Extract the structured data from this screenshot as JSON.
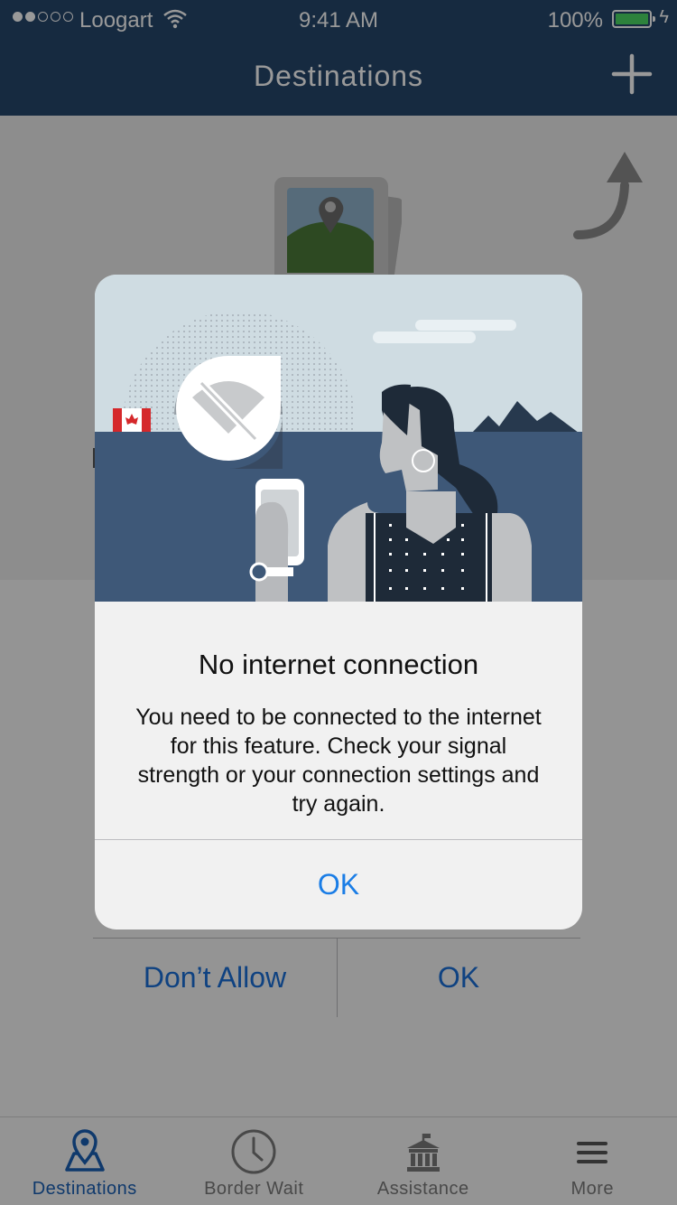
{
  "status_bar": {
    "carrier": "Loogart",
    "time": "9:41 AM",
    "battery": "100%"
  },
  "nav": {
    "title": "Destinations"
  },
  "permission": {
    "deny_label": "Don’t Allow",
    "ok_label": "OK"
  },
  "alert": {
    "title": "No internet connection",
    "message": "You need to be connected to the internet for this feature. Check your signal strength or your connection settings and try again.",
    "ok_label": "OK"
  },
  "tabs": [
    {
      "label": "Destinations",
      "icon": "map-pin-icon",
      "active": true
    },
    {
      "label": "Border Wait",
      "icon": "clock-icon",
      "active": false
    },
    {
      "label": "Assistance",
      "icon": "building-icon",
      "active": false
    },
    {
      "label": "More",
      "icon": "menu-icon",
      "active": false
    }
  ],
  "colors": {
    "nav_bar": "#26466b",
    "accent": "#1a5fb4",
    "battery": "#4cd964",
    "alert_button": "#1a7de6"
  }
}
